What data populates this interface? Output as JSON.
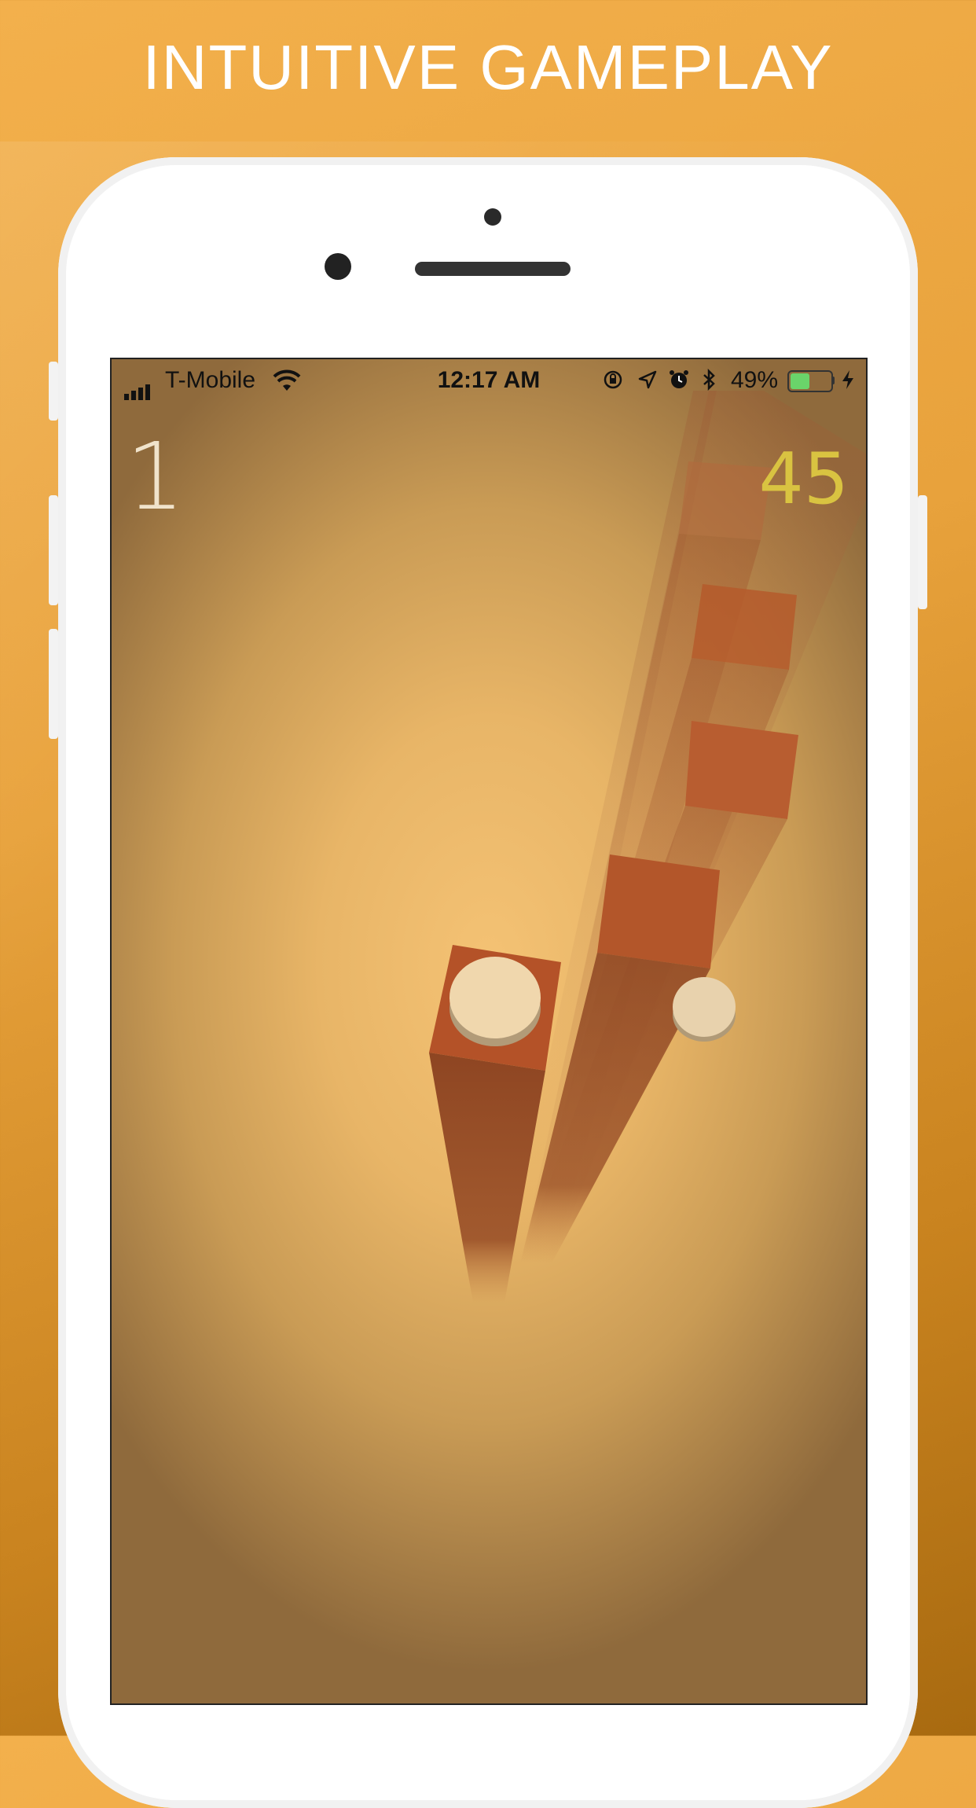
{
  "headline": "INTUITIVE GAMEPLAY",
  "status_bar": {
    "carrier": "T-Mobile",
    "time": "12:17 AM",
    "battery_percent": "49%",
    "icons": [
      "signal-icon",
      "wifi-icon",
      "orientation-lock-icon",
      "location-icon",
      "alarm-icon",
      "bluetooth-icon",
      "battery-icon",
      "charging-icon"
    ]
  },
  "game": {
    "level": "1",
    "score": "45",
    "colors": {
      "pillar": "#b5582a",
      "ball": "#f0d7ad",
      "score": "#d9c341",
      "level": "#f0e3cb"
    }
  }
}
